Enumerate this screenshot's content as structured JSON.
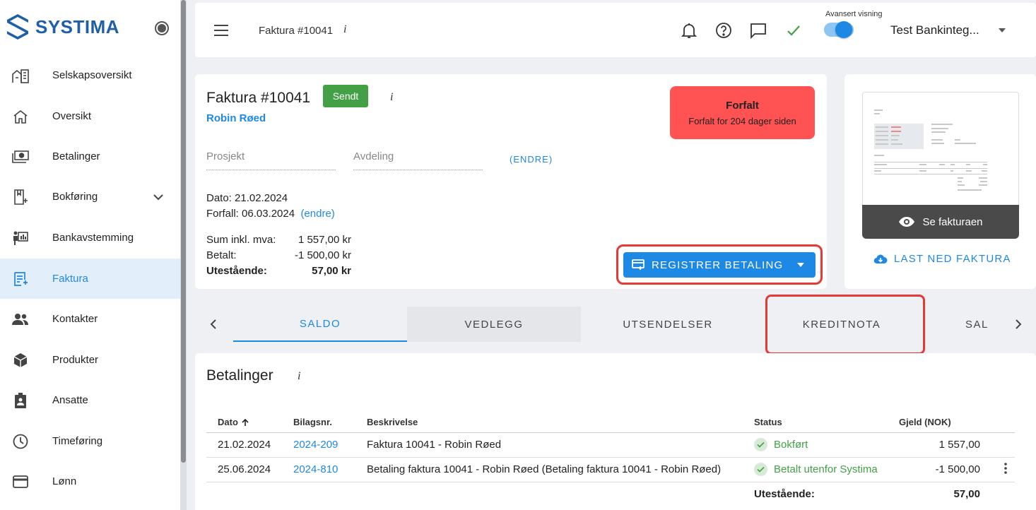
{
  "brand": {
    "name": "SYSTIMA",
    "color": "#1f5fa8",
    "accent": "#1e88e5"
  },
  "sidebar": {
    "items": [
      {
        "label": "Selskapsoversikt",
        "icon": "buildings-icon"
      },
      {
        "label": "Oversikt",
        "icon": "home-icon"
      },
      {
        "label": "Betalinger",
        "icon": "cash-icon"
      },
      {
        "label": "Bokføring",
        "icon": "book-add-icon",
        "expandable": true
      },
      {
        "label": "Bankavstemming",
        "icon": "bank-reconcile-icon"
      },
      {
        "label": "Faktura",
        "icon": "invoice-icon",
        "active": true
      },
      {
        "label": "Kontakter",
        "icon": "people-icon"
      },
      {
        "label": "Produkter",
        "icon": "box-icon"
      },
      {
        "label": "Ansatte",
        "icon": "badge-icon"
      },
      {
        "label": "Timeføring",
        "icon": "clock-icon"
      },
      {
        "label": "Lønn",
        "icon": "card-icon"
      }
    ]
  },
  "topbar": {
    "title": "Faktura #10041",
    "info": "i",
    "advanced_label": "Avansert visning",
    "advanced_on": true,
    "company": "Test Bankinteg..."
  },
  "invoice": {
    "title": "Faktura #10041",
    "status": "Sendt",
    "customer": "Robin Røed",
    "project_placeholder": "Prosjekt",
    "department_placeholder": "Avdeling",
    "change_label": "(ENDRE)",
    "overdue_title": "Forfalt",
    "overdue_text": "Forfalt for 204 dager siden",
    "date_line": "Dato: 21.02.2024",
    "due_line": "Forfall: 06.03.2024",
    "due_change": "(endre)",
    "sum_label": "Sum inkl. mva:",
    "sum_value": "1 557,00 kr",
    "paid_label": "Betalt:",
    "paid_value": "-1 500,00 kr",
    "outstanding_label": "Utestående:",
    "outstanding_value": "57,00 kr",
    "register_button": "REGISTRER BETALING"
  },
  "preview": {
    "see_label": "Se fakturaen",
    "download_label": "LAST NED FAKTURA"
  },
  "tabs": [
    "SALDO",
    "VEDLEGG",
    "UTSENDELSER",
    "KREDITNOTA",
    "SAL"
  ],
  "payments": {
    "title": "Betalinger",
    "columns": [
      "Dato",
      "Bilagsnr.",
      "Beskrivelse",
      "Status",
      "Gjeld (NOK)"
    ],
    "rows": [
      {
        "date": "21.02.2024",
        "voucher": "2024-209",
        "desc": "Faktura 10041 - Robin Røed",
        "status": "Bokført",
        "amount": "1 557,00"
      },
      {
        "date": "25.06.2024",
        "voucher": "2024-810",
        "desc": "Betaling faktura 10041 - Robin Røed (Betaling faktura 10041 - Robin Røed)",
        "status": "Betalt utenfor Systima",
        "amount": "-1 500,00"
      }
    ],
    "footer_label": "Utestående:",
    "footer_value": "57,00"
  }
}
